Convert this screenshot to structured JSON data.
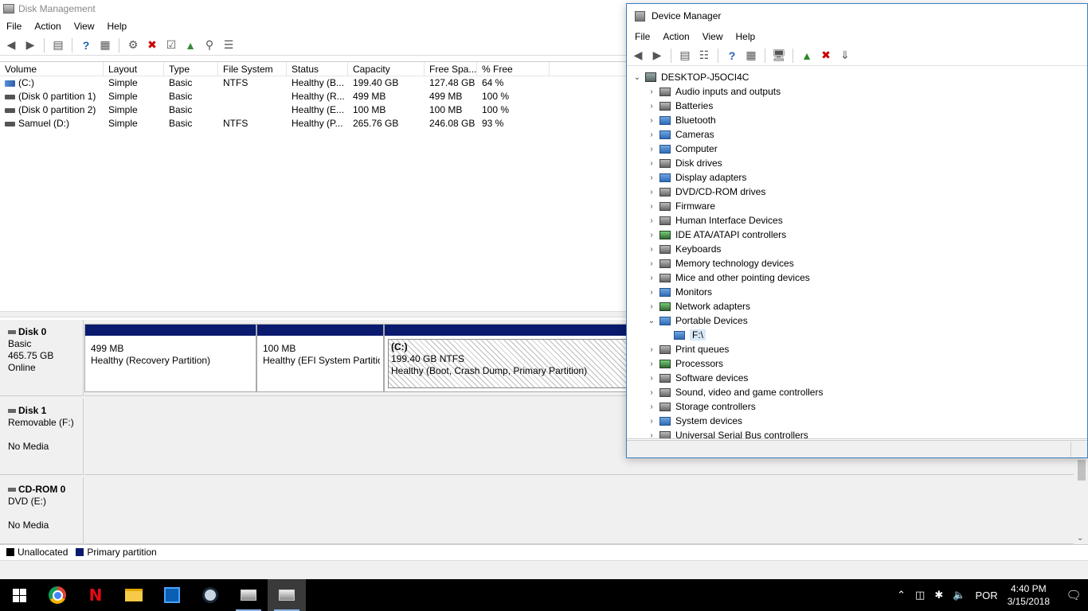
{
  "disk_management": {
    "title": "Disk Management",
    "menu": [
      "File",
      "Action",
      "View",
      "Help"
    ],
    "columns": [
      "Volume",
      "Layout",
      "Type",
      "File System",
      "Status",
      "Capacity",
      "Free Spa...",
      "% Free"
    ],
    "volumes": [
      {
        "volume": "(C:)",
        "layout": "Simple",
        "type": "Basic",
        "fs": "NTFS",
        "status": "Healthy (B...",
        "capacity": "199.40 GB",
        "free": "127.48 GB",
        "pct": "64 %"
      },
      {
        "volume": "(Disk 0 partition 1)",
        "layout": "Simple",
        "type": "Basic",
        "fs": "",
        "status": "Healthy (R...",
        "capacity": "499 MB",
        "free": "499 MB",
        "pct": "100 %"
      },
      {
        "volume": "(Disk 0 partition 2)",
        "layout": "Simple",
        "type": "Basic",
        "fs": "",
        "status": "Healthy (E...",
        "capacity": "100 MB",
        "free": "100 MB",
        "pct": "100 %"
      },
      {
        "volume": "Samuel (D:)",
        "layout": "Simple",
        "type": "Basic",
        "fs": "NTFS",
        "status": "Healthy (P...",
        "capacity": "265.76 GB",
        "free": "246.08 GB",
        "pct": "93 %"
      }
    ],
    "disks": [
      {
        "name": "Disk 0",
        "line1": "Basic",
        "line2": "465.75 GB",
        "line3": "Online",
        "partitions": [
          {
            "title": "",
            "size": "499 MB",
            "status": "Healthy (Recovery Partition)"
          },
          {
            "title": "",
            "size": "100 MB",
            "status": "Healthy (EFI System Partitio"
          },
          {
            "title": "(C:)",
            "size": "199.40 GB NTFS",
            "status": "Healthy (Boot, Crash Dump, Primary Partition)"
          }
        ]
      },
      {
        "name": "Disk 1",
        "line1": "Removable (F:)",
        "line2": "",
        "line3": "No Media"
      },
      {
        "name": "CD-ROM 0",
        "line1": "DVD (E:)",
        "line2": "",
        "line3": "No Media"
      }
    ],
    "legend": {
      "unallocated": "Unallocated",
      "primary": "Primary partition",
      "unallocated_color": "#000000",
      "primary_color": "#0a1a6e"
    }
  },
  "device_manager": {
    "title": "Device Manager",
    "menu": [
      "File",
      "Action",
      "View",
      "Help"
    ],
    "root": "DESKTOP-J5OCI4C",
    "categories": [
      {
        "label": "Audio inputs and outputs",
        "icon": "speaker-icon"
      },
      {
        "label": "Batteries",
        "icon": "battery-icon"
      },
      {
        "label": "Bluetooth",
        "icon": "bluetooth-icon"
      },
      {
        "label": "Cameras",
        "icon": "camera-icon"
      },
      {
        "label": "Computer",
        "icon": "computer-icon"
      },
      {
        "label": "Disk drives",
        "icon": "disk-drive-icon"
      },
      {
        "label": "Display adapters",
        "icon": "display-adapter-icon"
      },
      {
        "label": "DVD/CD-ROM drives",
        "icon": "dvd-icon"
      },
      {
        "label": "Firmware",
        "icon": "firmware-icon"
      },
      {
        "label": "Human Interface Devices",
        "icon": "hid-icon"
      },
      {
        "label": "IDE ATA/ATAPI controllers",
        "icon": "ide-icon"
      },
      {
        "label": "Keyboards",
        "icon": "keyboard-icon"
      },
      {
        "label": "Memory technology devices",
        "icon": "memory-icon"
      },
      {
        "label": "Mice and other pointing devices",
        "icon": "mouse-icon"
      },
      {
        "label": "Monitors",
        "icon": "monitor-icon"
      },
      {
        "label": "Network adapters",
        "icon": "network-adapter-icon"
      },
      {
        "label": "Portable Devices",
        "icon": "portable-device-icon",
        "expanded": true,
        "children": [
          "F:\\"
        ]
      },
      {
        "label": "Print queues",
        "icon": "printer-icon"
      },
      {
        "label": "Processors",
        "icon": "processor-icon"
      },
      {
        "label": "Software devices",
        "icon": "software-device-icon"
      },
      {
        "label": "Sound, video and game controllers",
        "icon": "sound-controller-icon"
      },
      {
        "label": "Storage controllers",
        "icon": "storage-controller-icon"
      },
      {
        "label": "System devices",
        "icon": "system-device-icon"
      },
      {
        "label": "Universal Serial Bus controllers",
        "icon": "usb-icon"
      }
    ]
  },
  "taskbar": {
    "apps": [
      "start-icon",
      "chrome-icon",
      "netflix-icon",
      "file-explorer-icon",
      "store-icon",
      "steam-icon",
      "device-manager-icon",
      "disk-management-icon"
    ],
    "language": "POR",
    "time": "4:40 PM",
    "date": "3/15/2018"
  }
}
